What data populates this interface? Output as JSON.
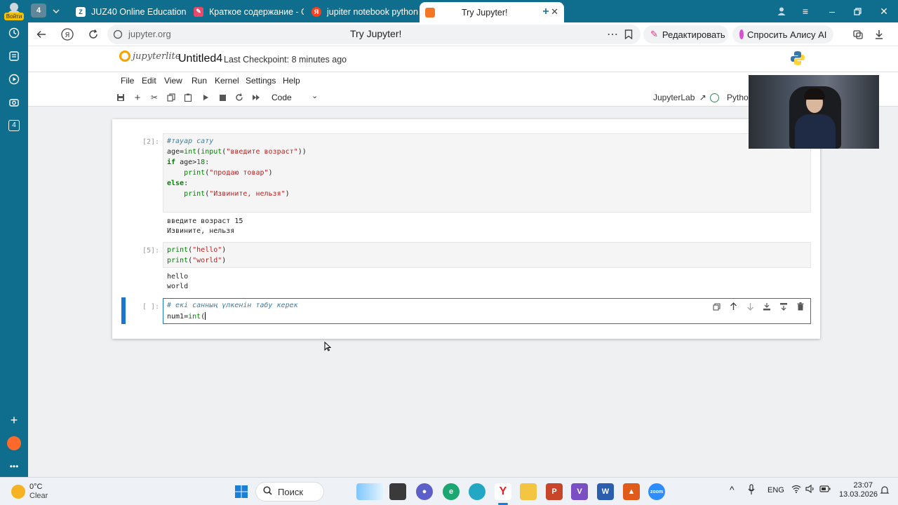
{
  "browser": {
    "sidebar_badge": "4",
    "login_label": "Войти",
    "tab_counter": "4",
    "tabs": [
      {
        "title": "JUZ40 Online Education"
      },
      {
        "title": "Краткое содержание - Qu"
      },
      {
        "title": "jupiter notebook python -"
      },
      {
        "title": "Try Jupyter!"
      }
    ],
    "url": "jupyter.org",
    "page_title": "Try Jupyter!",
    "edit_button": "Редактировать",
    "alice_button": "Спросить Алису AI"
  },
  "jupyter": {
    "logo_text": "jupyterlite",
    "notebook_title": "Untitled4",
    "checkpoint": "Last Checkpoint: 8 minutes ago",
    "menu": [
      "File",
      "Edit",
      "View",
      "Run",
      "Kernel",
      "Settings",
      "Help"
    ],
    "cell_type": "Code",
    "jupyterlab_label": "JupyterLab",
    "kernel_name": "Python"
  },
  "cells": [
    {
      "prompt": "[2]:",
      "code": [
        "#тауар сату",
        "age=int(input(\"введите возраст\"))",
        "if age>18:",
        "    print(\"продаю товар\")",
        "else:",
        "    print(\"Извините, нельзя\")"
      ],
      "output": [
        "введите возраст 15",
        "Извините, нельзя"
      ]
    },
    {
      "prompt": "[5]:",
      "code": [
        "print(\"hello\")",
        "print(\"world\")"
      ],
      "output": [
        "hello",
        "world"
      ]
    },
    {
      "prompt": "[ ]:",
      "code": [
        "# екі санның үлкенін табу керек",
        "num1=int("
      ],
      "output": []
    }
  ],
  "taskbar": {
    "weather_temp": "0°C",
    "weather_desc": "Clear",
    "search_label": "Поиск",
    "language": "ENG",
    "time": "23:07",
    "date": "13.03.2026"
  }
}
